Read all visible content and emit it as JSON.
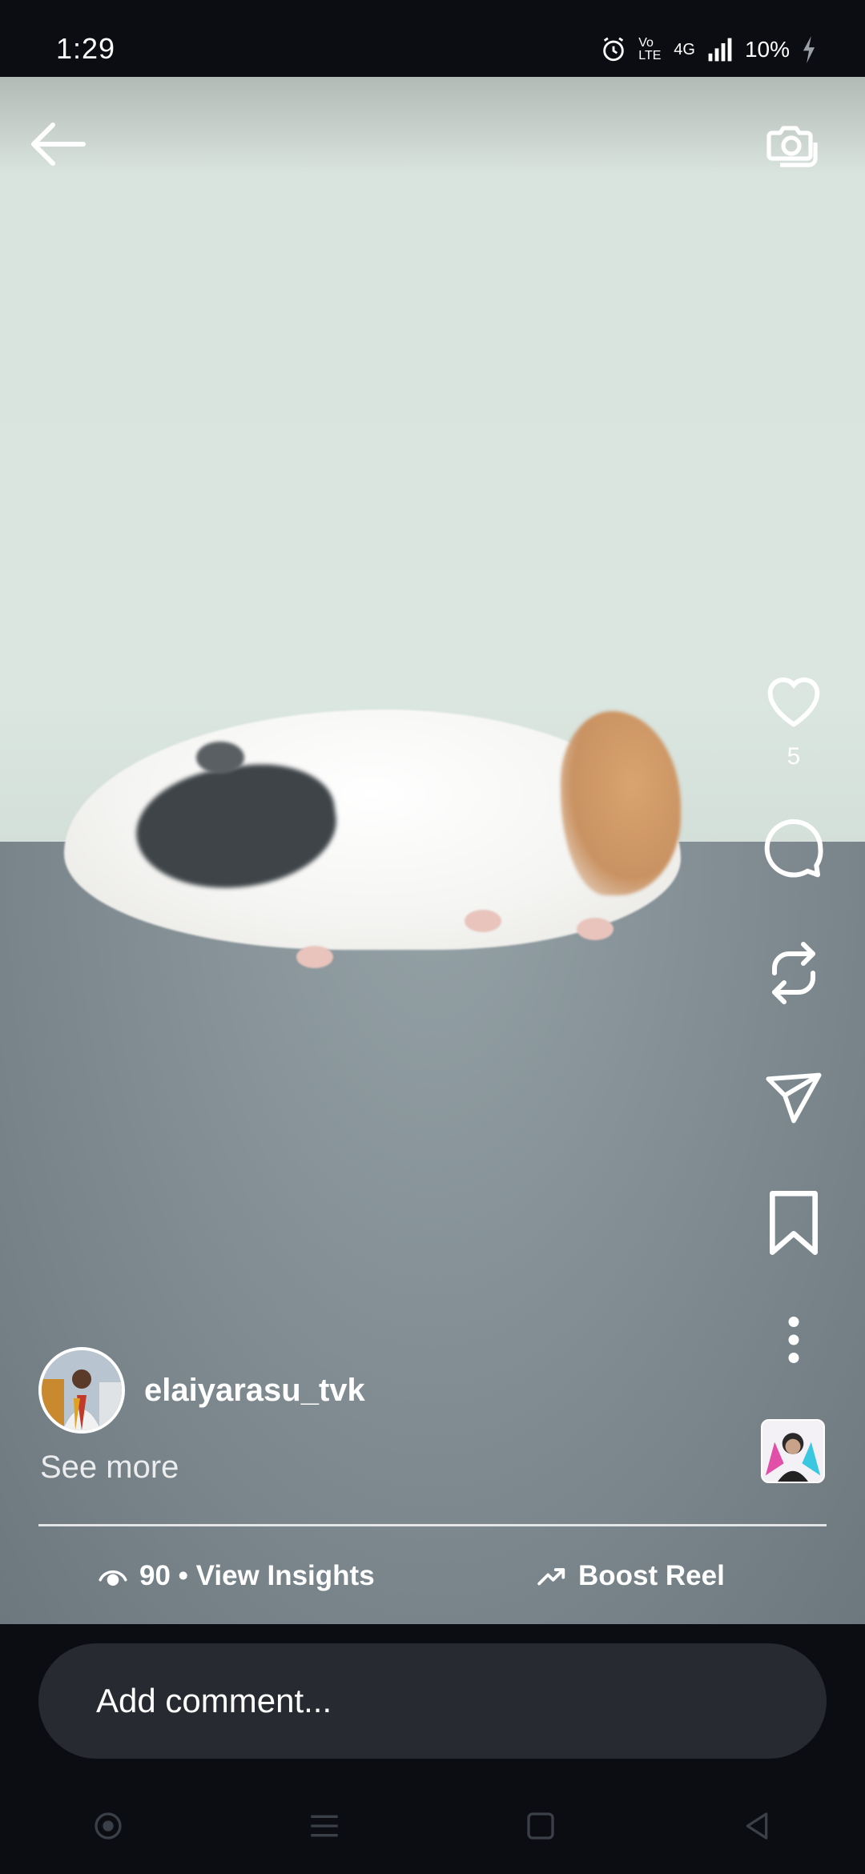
{
  "status_bar": {
    "time": "1:29",
    "network_volte": "Vo LTE",
    "network_type": "4G",
    "battery": "10%"
  },
  "reel": {
    "username": "elaiyarasu_tvk",
    "see_more": "See more",
    "like_count": "5",
    "view_insights": "90 • View Insights",
    "boost_reel": "Boost Reel"
  },
  "comment": {
    "placeholder": "Add comment..."
  },
  "icons": {
    "back": "back-arrow-icon",
    "camera": "camera-icon",
    "like": "heart-icon",
    "comment": "comment-icon",
    "repost": "repost-icon",
    "share": "send-icon",
    "save": "bookmark-icon",
    "more": "more-vertical-icon",
    "insights": "eye-icon",
    "boost": "trending-up-icon"
  },
  "colors": {
    "background": "#0b0d12",
    "comment_bar": "#272a30",
    "text": "#ffffff"
  }
}
